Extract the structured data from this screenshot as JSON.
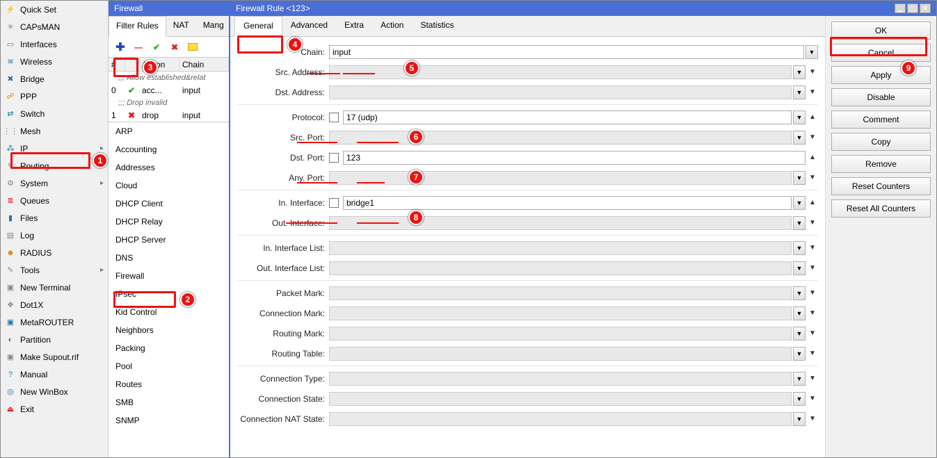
{
  "sidebar": [
    {
      "icon": "⚡",
      "label": "Quick Set",
      "arrow": false,
      "iconcls": "ic-orange"
    },
    {
      "icon": "✳",
      "label": "CAPsMAN",
      "arrow": false,
      "iconcls": "ic-gray"
    },
    {
      "icon": "▭",
      "label": "Interfaces",
      "arrow": false,
      "iconcls": "ic-green"
    },
    {
      "icon": "≋",
      "label": "Wireless",
      "arrow": false,
      "iconcls": "ic-blue"
    },
    {
      "icon": "✖",
      "label": "Bridge",
      "arrow": false,
      "iconcls": "ic-blue"
    },
    {
      "icon": "☍",
      "label": "PPP",
      "arrow": false,
      "iconcls": "ic-orange"
    },
    {
      "icon": "⇄",
      "label": "Switch",
      "arrow": false,
      "iconcls": "ic-blue"
    },
    {
      "icon": "⋮⋮",
      "label": "Mesh",
      "arrow": false,
      "iconcls": "ic-gray"
    },
    {
      "icon": "⁂",
      "label": "IP",
      "arrow": true,
      "iconcls": "ic-blue"
    },
    {
      "icon": "↯",
      "label": "Routing",
      "arrow": true,
      "iconcls": "ic-gray"
    },
    {
      "icon": "⚙",
      "label": "System",
      "arrow": true,
      "iconcls": "ic-gray"
    },
    {
      "icon": "≣",
      "label": "Queues",
      "arrow": false,
      "iconcls": "ic-red"
    },
    {
      "icon": "▮",
      "label": "Files",
      "arrow": false,
      "iconcls": "ic-blue"
    },
    {
      "icon": "▤",
      "label": "Log",
      "arrow": false,
      "iconcls": "ic-gray"
    },
    {
      "icon": "☻",
      "label": "RADIUS",
      "arrow": false,
      "iconcls": "ic-orange"
    },
    {
      "icon": "✎",
      "label": "Tools",
      "arrow": true,
      "iconcls": "ic-gray"
    },
    {
      "icon": "▣",
      "label": "New Terminal",
      "arrow": false,
      "iconcls": "ic-gray"
    },
    {
      "icon": "❖",
      "label": "Dot1X",
      "arrow": false,
      "iconcls": "ic-gray"
    },
    {
      "icon": "▣",
      "label": "MetaROUTER",
      "arrow": false,
      "iconcls": "ic-blue"
    },
    {
      "icon": "◐",
      "label": "Partition",
      "arrow": false,
      "iconcls": "ic-blue"
    },
    {
      "icon": "▣",
      "label": "Make Supout.rif",
      "arrow": false,
      "iconcls": "ic-gray"
    },
    {
      "icon": "?",
      "label": "Manual",
      "arrow": false,
      "iconcls": "ic-blue"
    },
    {
      "icon": "◎",
      "label": "New WinBox",
      "arrow": false,
      "iconcls": "ic-blue"
    },
    {
      "icon": "⏏",
      "label": "Exit",
      "arrow": false,
      "iconcls": "ic-red"
    }
  ],
  "fw": {
    "title": "Firewall",
    "tabs": [
      "Filter Rules",
      "NAT",
      "Mang"
    ],
    "activeTab": 0,
    "th": [
      "#",
      "",
      "Action",
      "Chain"
    ],
    "rows": [
      {
        "comment": ";;; Allow established&relat"
      },
      {
        "num": "0",
        "icon": "✔",
        "action": "acc...",
        "chain": "input"
      },
      {
        "comment": ";;; Drop invalid"
      },
      {
        "num": "1",
        "icon": "✖",
        "action": "drop",
        "chain": "input"
      }
    ],
    "submenu": [
      "ARP",
      "Accounting",
      "Addresses",
      "Cloud",
      "DHCP Client",
      "DHCP Relay",
      "DHCP Server",
      "DNS",
      "Firewall",
      "IPsec",
      "Kid Control",
      "Neighbors",
      "Packing",
      "Pool",
      "Routes",
      "SMB",
      "SNMP"
    ]
  },
  "rule": {
    "title": "Firewall Rule <123>",
    "tabs": [
      "General",
      "Advanced",
      "Extra",
      "Action",
      "Statistics"
    ],
    "activeTab": 0,
    "buttons": [
      "OK",
      "Cancel",
      "Apply",
      "Disable",
      "Comment",
      "Copy",
      "Remove",
      "Reset Counters",
      "Reset All Counters"
    ],
    "fields": {
      "chain": {
        "label": "Chain:",
        "value": "input",
        "dd": true
      },
      "srcaddr": {
        "label": "Src. Address:",
        "value": "",
        "dd": true,
        "ro": true,
        "tri": true
      },
      "dstaddr": {
        "label": "Dst. Address:",
        "value": "",
        "dd": true,
        "ro": true,
        "tri": true
      },
      "protocol": {
        "label": "Protocol:",
        "value": "17 (udp)",
        "dd": true,
        "chk": true,
        "up": true
      },
      "srcport": {
        "label": "Src. Port:",
        "value": "",
        "dd": true,
        "ro": true,
        "tri": true
      },
      "dstport": {
        "label": "Dst. Port:",
        "value": "123",
        "chk": true,
        "up": true
      },
      "anyport": {
        "label": "Any. Port:",
        "value": "",
        "dd": true,
        "ro": true,
        "tri": true
      },
      "iniface": {
        "label": "In. Interface:",
        "value": "bridge1",
        "dd": true,
        "chk": true,
        "up": true
      },
      "outiface": {
        "label": "Out. Interface:",
        "value": "",
        "dd": true,
        "ro": true,
        "tri": true
      },
      "inifacelist": {
        "label": "In. Interface List:",
        "value": "",
        "dd": true,
        "ro": true,
        "tri": true
      },
      "outifacelist": {
        "label": "Out. Interface List:",
        "value": "",
        "dd": true,
        "ro": true,
        "tri": true
      },
      "pktmark": {
        "label": "Packet Mark:",
        "value": "",
        "dd": true,
        "ro": true,
        "tri": true
      },
      "connmark": {
        "label": "Connection Mark:",
        "value": "",
        "dd": true,
        "ro": true,
        "tri": true
      },
      "routmark": {
        "label": "Routing Mark:",
        "value": "",
        "dd": true,
        "ro": true,
        "tri": true
      },
      "routtable": {
        "label": "Routing Table:",
        "value": "",
        "dd": true,
        "ro": true,
        "tri": true
      },
      "conntype": {
        "label": "Connection Type:",
        "value": "",
        "dd": true,
        "ro": true,
        "tri": true
      },
      "connstate": {
        "label": "Connection State:",
        "value": "",
        "dd": true,
        "ro": true,
        "tri": true
      },
      "connnat": {
        "label": "Connection NAT State:",
        "value": "",
        "dd": true,
        "ro": true,
        "tri": true
      }
    }
  },
  "badges": [
    "1",
    "2",
    "3",
    "4",
    "5",
    "6",
    "7",
    "8",
    "9"
  ]
}
